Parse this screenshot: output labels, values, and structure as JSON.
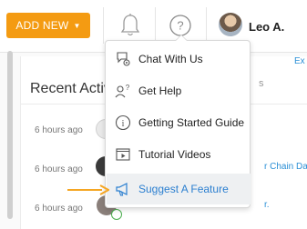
{
  "topbar": {
    "add_new_label": "ADD NEW",
    "add_new_caret": "▼",
    "user_name": "Leo A.",
    "accent_color": "#f49b12"
  },
  "page": {
    "section_title": "Recent Activ",
    "top_link": "Ex",
    "behind_fragment": "s",
    "activities": [
      {
        "time": "6 hours ago"
      },
      {
        "time": "6 hours ago",
        "link_fragment": "r Chain Day"
      },
      {
        "time": "6 hours ago",
        "text_fragment": "r."
      }
    ]
  },
  "help_menu": {
    "items": [
      {
        "label": "Chat With Us",
        "icon": "chat-gear-icon"
      },
      {
        "label": "Get Help",
        "icon": "person-question-icon"
      },
      {
        "label": "Getting Started Guide",
        "icon": "info-circle-icon"
      },
      {
        "label": "Tutorial Videos",
        "icon": "video-play-icon"
      },
      {
        "label": "Suggest A Feature",
        "icon": "megaphone-icon",
        "highlighted": true
      }
    ],
    "highlight_color": "#2b7fd0",
    "pointer_color": "#f5a623"
  }
}
